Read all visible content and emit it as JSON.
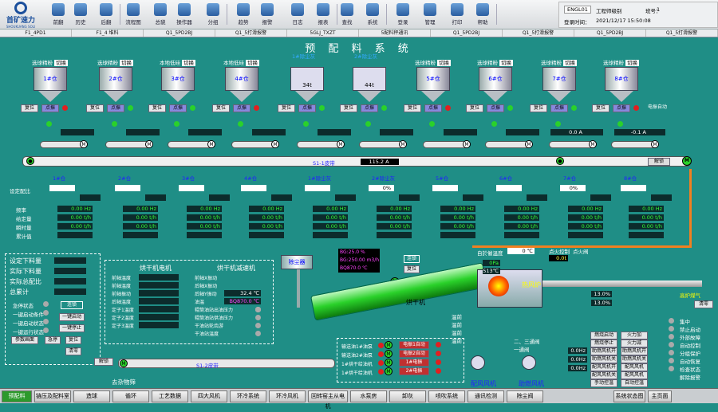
{
  "app": {
    "logo_name": "首矿速力",
    "logo_sub": "SHOUKUANG SOLI"
  },
  "toolbar": [
    {
      "label": "前翻",
      "icon": "back-arrow-icon"
    },
    {
      "label": "历史",
      "icon": "history-icon"
    },
    {
      "label": "后翻",
      "icon": "forward-arrow-icon"
    },
    {
      "label": "流程图",
      "icon": "flowchart-icon"
    },
    {
      "label": "总貌",
      "icon": "overview-icon"
    },
    {
      "label": "操作器",
      "icon": "operator-icon"
    },
    {
      "label": "分组",
      "icon": "group-icon"
    },
    {
      "label": "趋势",
      "icon": "trend-icon"
    },
    {
      "label": "报警",
      "icon": "alarm-icon"
    },
    {
      "label": "日志",
      "icon": "log-icon"
    },
    {
      "label": "报表",
      "icon": "report-icon"
    },
    {
      "label": "查找",
      "icon": "search-icon"
    },
    {
      "label": "系统",
      "icon": "system-icon"
    },
    {
      "label": "登录",
      "icon": "login-icon"
    },
    {
      "label": "管理",
      "icon": "manage-icon"
    },
    {
      "label": "打印",
      "icon": "print-icon"
    },
    {
      "label": "帮助",
      "icon": "help-icon"
    }
  ],
  "status": {
    "user": "ENGL01",
    "level_label": "工程师级别",
    "shift_label": "班号：",
    "shift": "1",
    "login_label": "登录时间：",
    "login_time": "2021/12/17  15:50:08"
  },
  "alarms": [
    "F1_4PD1",
    "F1_4 堆料",
    "Q1_5PD2BJ",
    "Q1_5打滑报警",
    "5GLJ_TXZT",
    "5配料秤通讯",
    "Q1_5PD2BJ",
    "Q1_5打滑报警",
    "Q1_5PD2BJ",
    "Q1_5打滑报警"
  ],
  "title": "预 配 料 系 统",
  "bins": [
    {
      "top": "选球精粉",
      "mode": "切换",
      "name": "1#仓"
    },
    {
      "top": "选球精粉",
      "mode": "切换",
      "name": "2#仓"
    },
    {
      "top": "本地低硅",
      "mode": "切换",
      "name": "3#仓"
    },
    {
      "top": "本地低硅",
      "mode": "切换",
      "name": "4#仓"
    },
    {
      "top": "1#除尘灰",
      "mode": "",
      "name": "",
      "weight": "34t"
    },
    {
      "top": "2#除尘灰",
      "mode": "",
      "name": "",
      "weight": "44t"
    },
    {
      "top": "选球精粉",
      "mode": "切换",
      "name": "5#仓"
    },
    {
      "top": "选球精粉",
      "mode": "切换",
      "name": "6#仓"
    },
    {
      "top": "选球精粉",
      "mode": "切换",
      "name": "7#仓"
    },
    {
      "top": "选球精粉",
      "mode": "切换",
      "name": "8#仓"
    }
  ],
  "bin_buttons": {
    "reset": "复位",
    "point": "点振",
    "auto": "电振自动"
  },
  "currents": {
    "c7": "0.0 A",
    "c8": "-0.1 A",
    "belt": "115.2 A"
  },
  "belt1": {
    "name": "S1-1皮带",
    "unlock": "解锁"
  },
  "feeders": [
    "1#仓",
    "2#仓",
    "3#仓",
    "4#仓",
    "1#除尘灰",
    "2#除尘灰",
    "5#仓",
    "6#仓",
    "7#仓",
    "8#仓"
  ],
  "ratio_label": "设定配比",
  "pct": [
    "0%",
    "0%"
  ],
  "rows": {
    "labels": [
      "频率",
      "给定量",
      "瞬时量",
      "累计值"
    ],
    "freq": "0.00 Hz",
    "tph": "0.00 t/h"
  },
  "left_panel": {
    "items": [
      {
        "label": "设定下料量"
      },
      {
        "label": "实际下料量"
      },
      {
        "label": "实际总配比"
      },
      {
        "label": "总累计"
      }
    ],
    "sw": [
      "急停状态",
      "一键启动条件",
      "一键启动状态",
      "一键运行状态"
    ],
    "btns": {
      "interlock": "连锁",
      "start": "一键启动",
      "stop": "一键停止",
      "params": "参数画面",
      "emergency": "急停",
      "reset": "复位",
      "clear": "清零"
    }
  },
  "motor_panel": {
    "title1": "烘干机电机",
    "title2": "烘干机减速机",
    "temp": "32.4 ℃",
    "temp2": "BQ870.0 ℃",
    "left": [
      "前轴温度",
      "前轴温度",
      "前轴振动",
      "后轴温度",
      "定子1温度",
      "定子2温度",
      "定子3温度"
    ],
    "right": [
      "前轴X振动",
      "后轴X振动",
      "后轴Y振动",
      "油温",
      "辊筒油站出油压力",
      "辊筒油站供油压力",
      "干油站轮齿游",
      "干油站温度"
    ],
    "status1": "去杂物筛"
  },
  "dust": {
    "label": "除尘器",
    "gas": [
      "BG:25.0  %",
      "BG:250.00 m3/h",
      "BQ870.0  ℃"
    ],
    "interlock": "连锁",
    "reset": "复位"
  },
  "dryer": "烘干机",
  "stove": {
    "title": "热风炉",
    "hot_temp": "自於催温度",
    "t1": "0 ℃",
    "t2": "0Pa",
    "t3": "513℃",
    "pt_lbl": "点火控制",
    "valve": "点火阀",
    "t4": "0.0t",
    "fan1": "配风风机",
    "fan2": "助燃风机",
    "gas": "高炉煤气",
    "clear": "清零"
  },
  "stove_rows": [
    "温前",
    "温前",
    "温前",
    "温前"
  ],
  "checks": [
    "二、三通阀",
    "一通阀"
  ],
  "mid_panel": {
    "rows": [
      "输送油1#油泵",
      "输送油2#油泵",
      "1#烘干给油机",
      "1#烘干给油机"
    ],
    "cmd": [
      "电振1自动",
      "电振2自动",
      "1#电振",
      "2#电振"
    ]
  },
  "belt2": {
    "name": "S1-2皮带",
    "unlock": "解锁"
  },
  "right_panel": [
    "集中",
    "禁止启动",
    "外部故障",
    "自动控制",
    "分组保护",
    "自动恢复",
    "检查状态",
    "解除报警"
  ],
  "fan_table": [
    [
      "燃烧启动",
      "火力加"
    ],
    [
      "燃烧停止",
      "火力减"
    ],
    [
      "助燃风机开",
      "助燃风机开"
    ],
    [
      "助燃风机关",
      "助燃风机关"
    ],
    [
      "配风风机开",
      "配风风机"
    ],
    [
      "配风风机关",
      "配风风机"
    ],
    [
      "手动控温",
      "自动控温"
    ]
  ],
  "pct_small": [
    "13.0%",
    "13.0%"
  ],
  "stove_flow": [
    "0.0Hz",
    "0.0Hz",
    "0.0Hz"
  ],
  "nav": [
    "预配料",
    "链压及配料室",
    "造球",
    "循环",
    "工艺数据",
    "四大风机",
    "环冷系统",
    "环冷风机",
    "回转窑主从电机",
    "水泵房",
    "卸灰",
    "喷吹系统",
    "通讯检测",
    "除尘阀",
    "系统状态图",
    "主页面"
  ]
}
